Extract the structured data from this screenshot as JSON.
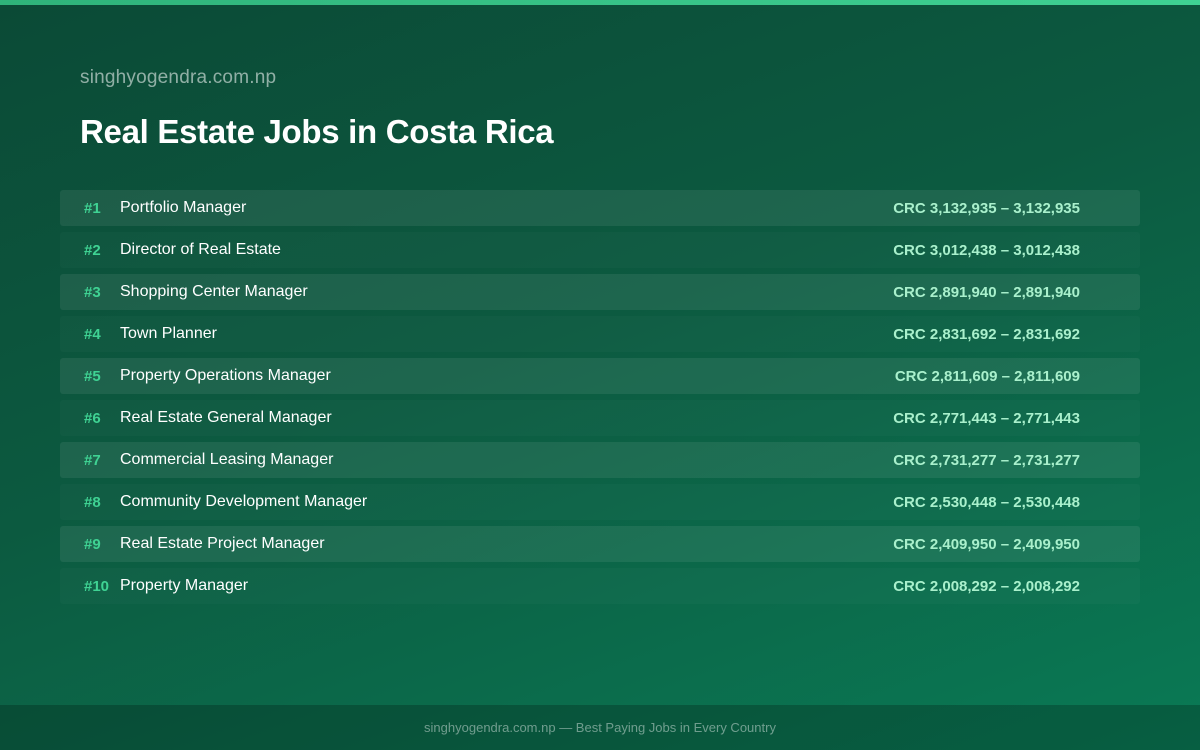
{
  "header": {
    "site": "singhyogendra.com.np",
    "title": "Real Estate Jobs in Costa Rica"
  },
  "jobs": [
    {
      "rank": "#1",
      "title": "Portfolio Manager",
      "salary": "CRC 3,132,935 – 3,132,935"
    },
    {
      "rank": "#2",
      "title": "Director of Real Estate",
      "salary": "CRC 3,012,438 – 3,012,438"
    },
    {
      "rank": "#3",
      "title": "Shopping Center Manager",
      "salary": "CRC 2,891,940 – 2,891,940"
    },
    {
      "rank": "#4",
      "title": "Town Planner",
      "salary": "CRC 2,831,692 – 2,831,692"
    },
    {
      "rank": "#5",
      "title": "Property Operations Manager",
      "salary": "CRC 2,811,609 – 2,811,609"
    },
    {
      "rank": "#6",
      "title": "Real Estate General Manager",
      "salary": "CRC 2,771,443 – 2,771,443"
    },
    {
      "rank": "#7",
      "title": "Commercial Leasing Manager",
      "salary": "CRC 2,731,277 – 2,731,277"
    },
    {
      "rank": "#8",
      "title": "Community Development Manager",
      "salary": "CRC 2,530,448 – 2,530,448"
    },
    {
      "rank": "#9",
      "title": "Real Estate Project Manager",
      "salary": "CRC 2,409,950 – 2,409,950"
    },
    {
      "rank": "#10",
      "title": "Property Manager",
      "salary": "CRC 2,008,292 – 2,008,292"
    }
  ],
  "footer": {
    "text": "singhyogendra.com.np — Best Paying Jobs in Every Country"
  },
  "colors": {
    "accent": "#3fd293",
    "salary": "#a9f0cc",
    "background_start": "#0b4a36",
    "background_end": "#0a7a55"
  }
}
